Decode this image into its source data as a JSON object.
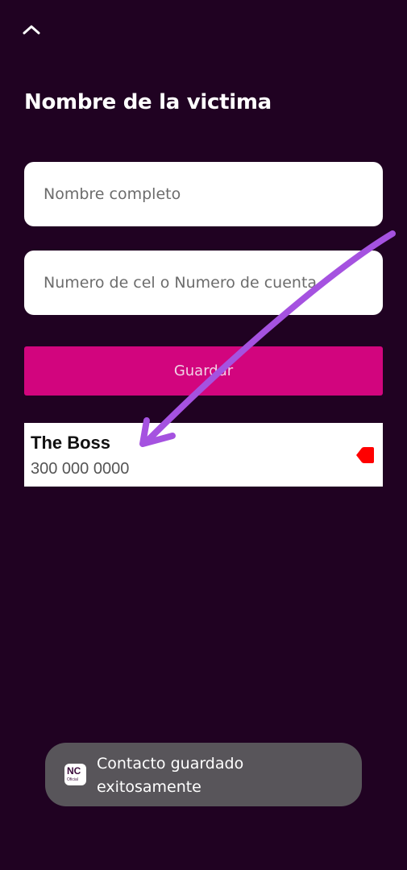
{
  "header": {
    "back_icon": "chevron-up-icon",
    "title": "Nombre de la victima"
  },
  "form": {
    "name_placeholder": "Nombre completo",
    "number_placeholder": "Numero de cel o Numero de cuenta",
    "save_label": "Guardar"
  },
  "contacts": [
    {
      "name": "The Boss",
      "number": "300 000 0000",
      "delete_icon": "delete-tag-icon"
    }
  ],
  "toast": {
    "icon": "app-logo-icon",
    "icon_text": "NC",
    "icon_subtext": "Oficial",
    "message_line1": "Contacto guardado",
    "message_line2": "exitosamente"
  },
  "annotation": {
    "icon": "purple-arrow-annotation",
    "color": "#a552e0"
  },
  "colors": {
    "background": "#200222",
    "primary": "#d2057e",
    "toast": "#58555a",
    "delete": "#ff0000"
  }
}
